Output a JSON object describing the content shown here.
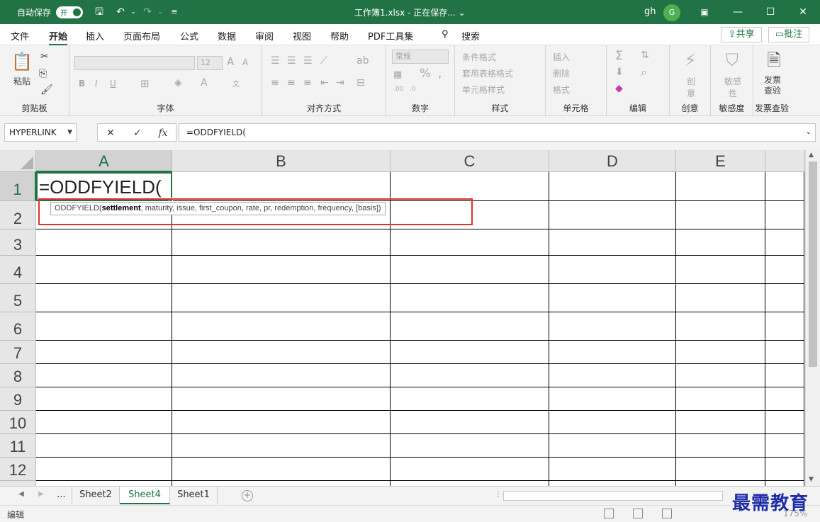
{
  "titlebar": {
    "autosave_label": "自动保存",
    "toggle_text": "开",
    "title": "工作簿1.xlsx - 正在保存... ⌄",
    "user": "gh",
    "avatar_letter": "G"
  },
  "menu": {
    "tabs": [
      "文件",
      "开始",
      "插入",
      "页面布局",
      "公式",
      "数据",
      "审阅",
      "视图",
      "帮助",
      "PDF工具集"
    ],
    "search": "搜索",
    "share": "共享",
    "comment": "批注"
  },
  "ribbon": {
    "clipboard": {
      "label": "剪贴板",
      "paste": "粘贴"
    },
    "font": {
      "label": "字体",
      "size": "12",
      "bold": "B",
      "italic": "I",
      "underline": "U"
    },
    "alignment": {
      "label": "对齐方式"
    },
    "number": {
      "label": "数字",
      "format": "常规"
    },
    "styles": {
      "label": "样式",
      "conditional": "条件格式",
      "table": "套用表格格式",
      "cell": "单元格样式"
    },
    "cells": {
      "label": "单元格",
      "insert": "插入",
      "delete": "删除",
      "format": "格式"
    },
    "editing": {
      "label": "编辑"
    },
    "creativity": {
      "label": "创意",
      "btn": "创意"
    },
    "sensitivity": {
      "label": "敏感度",
      "btn": "敏感性"
    },
    "invoice": {
      "label": "发票查验",
      "btn1": "发票",
      "btn2": "查验"
    }
  },
  "formula_bar": {
    "name_box": "HYPERLINK",
    "cancel": "✕",
    "enter": "✓",
    "fx": "fx",
    "formula": "=ODDFYIELD("
  },
  "grid": {
    "columns": [
      "A",
      "B",
      "C",
      "D",
      "E"
    ],
    "rows": [
      "1",
      "2",
      "3",
      "4",
      "5",
      "6",
      "7",
      "8",
      "9",
      "10",
      "11",
      "12"
    ],
    "active_cell_text": "=ODDFYIELD(",
    "tooltip": {
      "func": "ODDFYIELD(",
      "current_arg": "settlement",
      "rest": ", maturity, issue, first_coupon, rate, pr, redemption, frequency, [basis])"
    }
  },
  "sheets": {
    "ellipsis": "...",
    "tabs": [
      "Sheet2",
      "Sheet4",
      "Sheet1"
    ],
    "active": "Sheet4"
  },
  "status": {
    "mode": "编辑",
    "zoom": "175%"
  },
  "watermark": "最需教育"
}
